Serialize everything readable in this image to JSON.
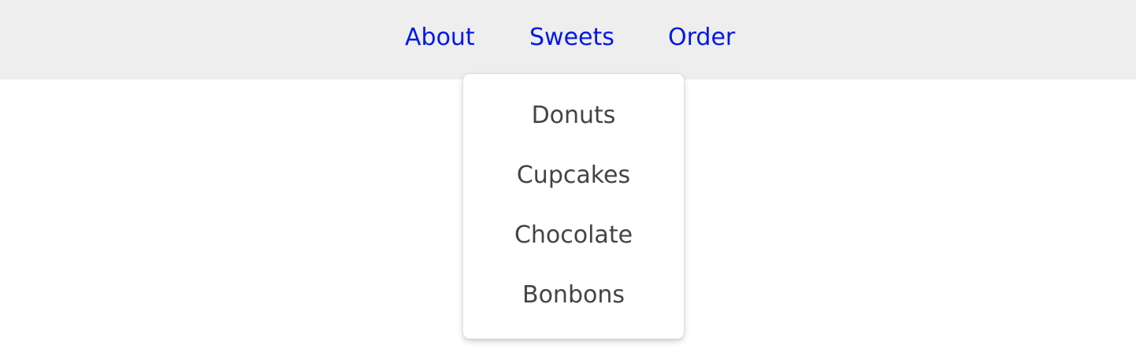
{
  "nav": {
    "links": [
      {
        "label": "About"
      },
      {
        "label": "Sweets"
      },
      {
        "label": "Order"
      }
    ],
    "background_color": "#eeeeee",
    "link_color": "#0018e6"
  },
  "dropdown": {
    "items": [
      {
        "label": "Donuts"
      },
      {
        "label": "Cupcakes"
      },
      {
        "label": "Chocolate"
      },
      {
        "label": "Bonbons"
      }
    ],
    "text_color": "#444444"
  }
}
